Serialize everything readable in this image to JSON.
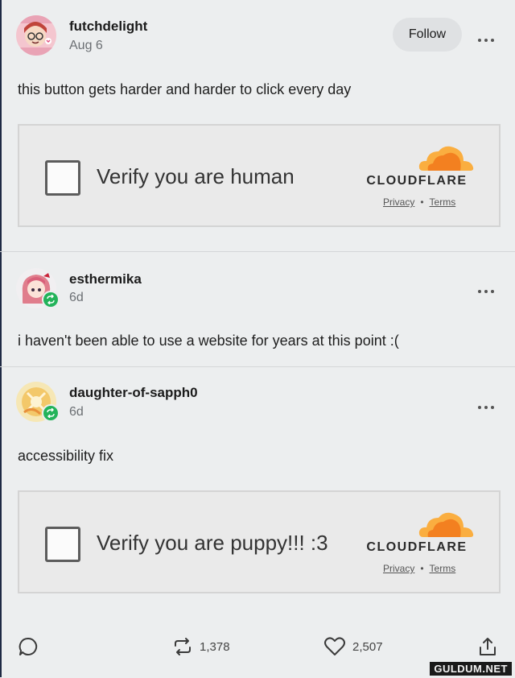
{
  "posts": [
    {
      "username": "futchdelight",
      "meta": "Aug 6",
      "follow_label": "Follow",
      "text": "this button gets harder and harder to click every day",
      "captcha": {
        "label": "Verify you are human",
        "brand": "CLOUDFLARE",
        "privacy": "Privacy",
        "separator": "•",
        "terms": "Terms"
      }
    },
    {
      "username": "esthermika",
      "meta": "6d",
      "text": "i haven't been able to use a website for years at this point :("
    },
    {
      "username": "daughter-of-sapph0",
      "meta": "6d",
      "text": "accessibility fix",
      "captcha": {
        "label": "Verify you are puppy!!! :3",
        "brand": "CLOUDFLARE",
        "privacy": "Privacy",
        "separator": "•",
        "terms": "Terms"
      }
    }
  ],
  "actions": {
    "reblogs": "1,378",
    "likes": "2,507"
  },
  "watermark": "GULDUM.NET",
  "icons": [
    "more-icon",
    "reblog-badge-icon",
    "cloudflare-cloud-icon",
    "comment-icon",
    "reblog-icon",
    "heart-icon",
    "share-icon"
  ],
  "colors": {
    "background": "#eceeef",
    "reblog_badge": "#23b35a",
    "cloudflare_orange": "#f38020",
    "cloudflare_light": "#faae40"
  }
}
